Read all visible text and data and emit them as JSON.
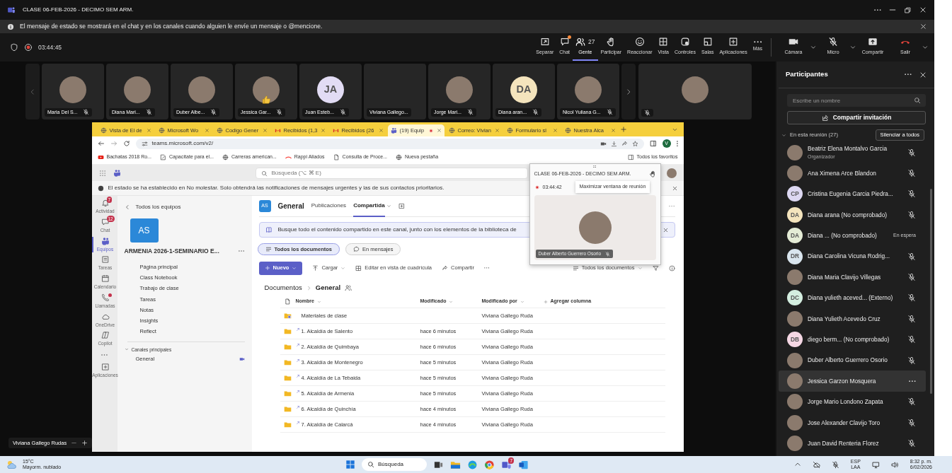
{
  "window": {
    "title": "CLASE 06-FEB-2026 - DECIMO SEM ARM."
  },
  "notice": {
    "text": "El mensaje de estado se mostrará en el chat y en los canales cuando alguien le envíe un mensaje o @mencione."
  },
  "meeting_bar": {
    "recording": true,
    "timer": "03:44:45",
    "actions": [
      {
        "label": "Separar",
        "alert": false,
        "selected": false
      },
      {
        "label": "Chat",
        "alert": true,
        "selected": false
      },
      {
        "label": "Gente",
        "count": "27",
        "alert": false,
        "selected": true
      },
      {
        "label": "Participar",
        "alert": false,
        "selected": false
      },
      {
        "label": "Reaccionar",
        "alert": false,
        "selected": false
      },
      {
        "label": "Vista",
        "alert": false,
        "selected": false
      },
      {
        "label": "Controles",
        "alert": false,
        "selected": false
      },
      {
        "label": "Salas",
        "alert": false,
        "selected": false
      },
      {
        "label": "Aplicaciones",
        "alert": false,
        "selected": false
      },
      {
        "label": "Más",
        "alert": false,
        "selected": false
      }
    ],
    "devices": [
      {
        "label": "Cámara",
        "kind": "camera",
        "caret": true
      },
      {
        "label": "Micro",
        "kind": "mic",
        "caret": true
      },
      {
        "label": "Compartir",
        "kind": "share",
        "caret": false
      },
      {
        "label": "Salir",
        "kind": "leave",
        "caret": true
      }
    ]
  },
  "stage": {
    "tiles": [
      {
        "name": "Maria Del S...",
        "kind": "photo",
        "muted": true,
        "reacting": false
      },
      {
        "name": "Diana Mari...",
        "kind": "photo",
        "muted": true,
        "reacting": false
      },
      {
        "name": "Duber Albe...",
        "kind": "photo",
        "muted": true,
        "reacting": false
      },
      {
        "name": "Jessica Gar...",
        "kind": "photo",
        "muted": true,
        "reacting": true
      },
      {
        "name": "Juan Esteb...",
        "kind": "initials",
        "initials": "JA",
        "color": "#e2dcf4",
        "muted": true,
        "reacting": false
      },
      {
        "name": "Viviana Gallego...",
        "kind": "video",
        "muted": false,
        "reacting": false
      },
      {
        "name": "Jorge Mari...",
        "kind": "photo",
        "muted": true,
        "reacting": false
      },
      {
        "name": "Diana aran...",
        "kind": "initials",
        "initials": "DA",
        "color": "#f4e4bd",
        "muted": true,
        "reacting": false
      },
      {
        "name": "Nicol Yuliana G...",
        "kind": "photo",
        "muted": true,
        "reacting": false
      }
    ],
    "spotlight": {
      "kind": "photo",
      "muted": true
    },
    "presenter": "Viviana Gallego Rudas"
  },
  "shared_screen": {
    "tabs": [
      {
        "label": "Vista de El de",
        "selected": false,
        "recording": false
      },
      {
        "label": "Microsoft Wo",
        "selected": false,
        "recording": false
      },
      {
        "label": "Codigo Gener",
        "selected": false,
        "recording": false
      },
      {
        "label": "Recibidos (1,3",
        "selected": false,
        "recording": false
      },
      {
        "label": "Recibidos (26",
        "selected": false,
        "recording": false
      },
      {
        "label": "(19) Equip",
        "selected": true,
        "recording": true
      },
      {
        "label": "Correo: Vivian",
        "selected": false,
        "recording": false
      },
      {
        "label": "Formulario sl",
        "selected": false,
        "recording": false
      },
      {
        "label": "Nuestra Alca",
        "selected": false,
        "recording": false
      }
    ],
    "url": "teams.microsoft.com/v2/",
    "profile_initial": "V",
    "bookmarks": [
      "Bachatas 2018 Ro...",
      "Capacítate para el...",
      "Carreras american...",
      "Rappi Aliados",
      "Consulta de Proce...",
      "Nueva pestaña"
    ],
    "all_bookmarks": "Todos los favoritos",
    "search_placeholder": "Búsqueda (⌥ ⌘ E)",
    "status_notice": "El estado se ha establecido en No molestar. Solo obtendrá las notificaciones de mensajes urgentes y las de sus contactos prioritarios.",
    "rail": [
      {
        "kind": "app",
        "label": "Actividad",
        "badge": "7",
        "dot": false,
        "selected": false
      },
      {
        "kind": "app",
        "label": "Chat",
        "badge": "12",
        "dot": false,
        "selected": false
      },
      {
        "kind": "app",
        "label": "Equipos",
        "dot": false,
        "selected": true
      },
      {
        "kind": "app",
        "label": "Tareas",
        "dot": false,
        "selected": false
      },
      {
        "kind": "app",
        "label": "Calendario",
        "dot": false,
        "selected": false
      },
      {
        "kind": "app",
        "label": "Llamadas",
        "dot": true,
        "selected": false
      },
      {
        "kind": "app",
        "label": "OneDrive",
        "dot": false,
        "selected": false
      },
      {
        "kind": "app",
        "label": "Copilot",
        "dot": false,
        "selected": false
      },
      {
        "kind": "more"
      },
      {
        "kind": "app",
        "label": "Aplicaciones",
        "dot": false,
        "selected": false
      }
    ],
    "team": {
      "back": "Todos los equipos",
      "initials": "AS",
      "name": "ARMENIA 2026-1-SEMINARIO E...",
      "nav": [
        "Página principal",
        "Class Notebook",
        "Trabajo de clase",
        "Tareas",
        "Notas",
        "Insights",
        "Reflect"
      ],
      "section": "Canales principales",
      "expanded": true,
      "channels": [
        {
          "name": "General",
          "live": true
        }
      ]
    },
    "channel": {
      "initials": "AS",
      "name": "General",
      "tabs": [
        {
          "label": "Publicaciones",
          "selected": false
        },
        {
          "label": "Compartida",
          "selected": true
        }
      ],
      "banner": "Busque todo el contenido compartido en este canal, junto con los elementos de la biblioteca de",
      "filters": [
        {
          "label": "Todos los documentos",
          "selected": true
        },
        {
          "label": "En mensajes",
          "selected": false
        }
      ],
      "commands": {
        "new": "Nuevo",
        "upload": "Cargar",
        "grid": "Editar en vista de cuadrícula",
        "share": "Compartir",
        "view": "Todos los documentos"
      },
      "breadcrumb": [
        "Documentos",
        "General"
      ],
      "columns": [
        "Nombre",
        "Modificado",
        "Modificado por"
      ],
      "add_column": "Agregar columna",
      "rows": [
        {
          "kind": "resources",
          "name": "Materiales de clase",
          "by": "Viviana Gallego Ruda"
        },
        {
          "kind": "shortcut",
          "name": "1. Alcaldía de Salento",
          "modified": "hace 6 minutos",
          "by": "Viviana Gallego Ruda"
        },
        {
          "kind": "shortcut",
          "name": "2. Alcaldía de Quimbaya",
          "modified": "hace 6 minutos",
          "by": "Viviana Gallego Ruda"
        },
        {
          "kind": "shortcut",
          "name": "3. Alcaldía de Montenegro",
          "modified": "hace 5 minutos",
          "by": "Viviana Gallego Ruda"
        },
        {
          "kind": "shortcut",
          "name": "4. Alcaldía de La Tebaida",
          "modified": "hace 5 minutos",
          "by": "Viviana Gallego Ruda"
        },
        {
          "kind": "shortcut",
          "name": "5. Alcaldía de Armenia",
          "modified": "hace 5 minutos",
          "by": "Viviana Gallego Ruda"
        },
        {
          "kind": "shortcut",
          "name": "6. Alcaldía de Quinchía",
          "modified": "hace 4 minutos",
          "by": "Viviana Gallego Ruda"
        },
        {
          "kind": "shortcut",
          "name": "7. Alcaldía de Calarcá",
          "modified": "hace 4 minutos",
          "by": "Viviana Gallego Ruda"
        }
      ]
    },
    "mini_window": {
      "title": "CLASE 06-FEB-2026 - DECIMO SEM ARM.",
      "recording": true,
      "timer": "03:44:42",
      "tooltip": "Maximizar ventana de reunión",
      "speaker": "Duber Alberto Guerrero Osorio",
      "muted": true
    }
  },
  "participants_panel": {
    "title": "Participantes",
    "search_placeholder": "Escribe un nombre",
    "invite": "Compartir invitación",
    "section": "En esta reunión (27)",
    "expanded": true,
    "mute_all": "Silenciar a todos",
    "people": [
      {
        "name": "Beatriz Elena Montalvo Garcia",
        "role": "Organizador",
        "kind": "photo",
        "muted": true,
        "selected": false
      },
      {
        "name": "Ana Ximena Arce Blandon",
        "kind": "photo",
        "muted": true,
        "selected": false
      },
      {
        "name": "Cristina Eugenia Garcia Piedra...",
        "kind": "initials",
        "initials": "CP",
        "color": "#ddd8f2",
        "muted": true,
        "selected": false
      },
      {
        "name": "Diana arana (No comprobado)",
        "kind": "initials",
        "initials": "DA",
        "color": "#f4e4bd",
        "muted": true,
        "selected": false
      },
      {
        "name": "Diana ...  (No comprobado)",
        "status": "En espera",
        "kind": "initials",
        "initials": "DA",
        "color": "#e4ecd6",
        "selected": false
      },
      {
        "name": "Diana Carolina Vicuna Rodrig...",
        "kind": "initials",
        "initials": "DR",
        "color": "#d9e5ee",
        "muted": true,
        "selected": false
      },
      {
        "name": "Diana Maria Clavijo Villegas",
        "kind": "photo",
        "muted": true,
        "selected": false
      },
      {
        "name": "Diana yulieth aceved... (Externo)",
        "kind": "initials",
        "initials": "DC",
        "color": "#d4eee0",
        "muted": true,
        "selected": false
      },
      {
        "name": "Diana Yulieth Acevedo Cruz",
        "kind": "photo",
        "muted": true,
        "selected": false
      },
      {
        "name": "diego berm... (No comprobado)",
        "kind": "initials",
        "initials": "DB",
        "color": "#f5d7e4",
        "muted": true,
        "selected": false
      },
      {
        "name": "Duber Alberto Guerrero Osorio",
        "kind": "photo",
        "muted": true,
        "selected": false
      },
      {
        "name": "Jessica Garzon Mosquera",
        "kind": "photo",
        "selected": true
      },
      {
        "name": "Jorge Mario Londono Zapata",
        "kind": "photo",
        "muted": true,
        "selected": false
      },
      {
        "name": "Jose Alexander Clavijo Toro",
        "kind": "photo",
        "muted": true,
        "selected": false
      },
      {
        "name": "Juan David Renteria Florez",
        "kind": "photo",
        "muted": true,
        "selected": false
      }
    ]
  },
  "taskbar": {
    "temperature": "15°C",
    "weather": "Mayorm. nublado",
    "search": "Búsqueda",
    "teams_badge": "7",
    "language": [
      "ESP",
      "LAA"
    ],
    "time": "8:32 p. m.",
    "date": "6/02/2026"
  }
}
